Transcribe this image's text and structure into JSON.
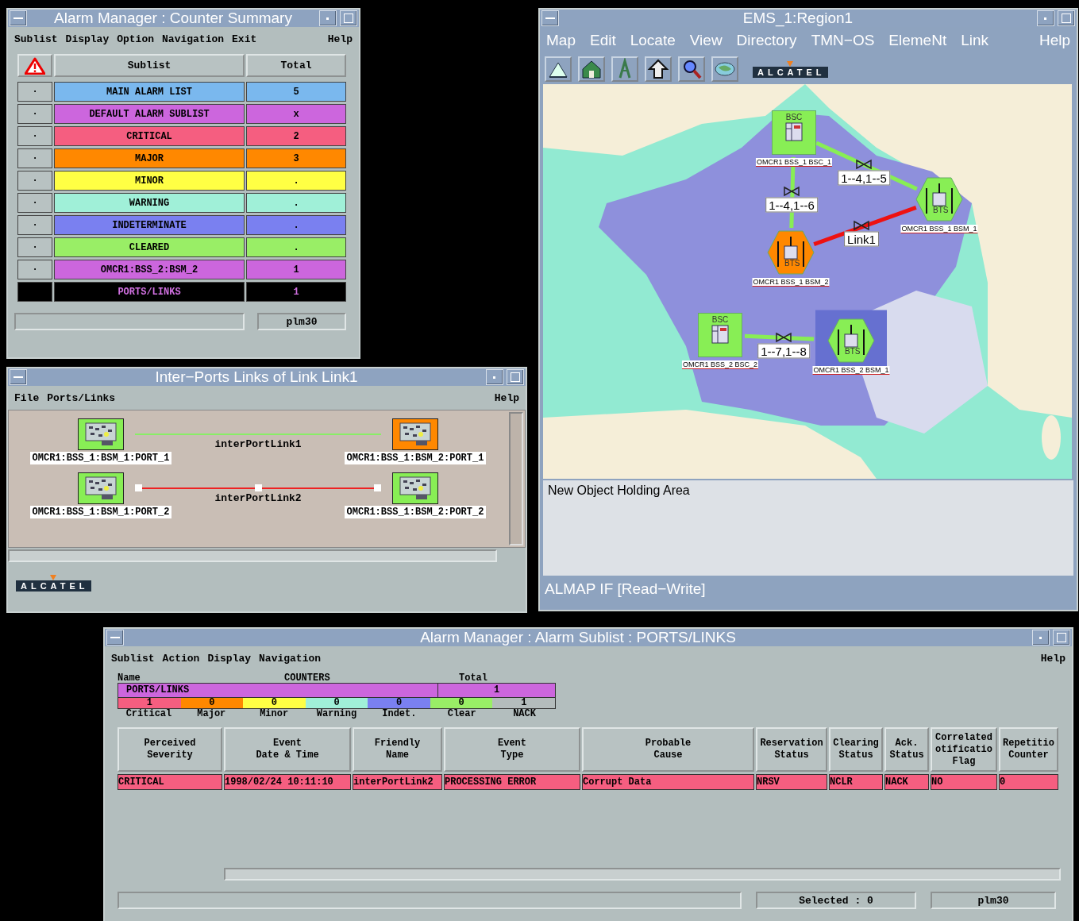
{
  "counter_summary": {
    "title": "Alarm Manager : Counter Summary",
    "menu": [
      "Sublist",
      "Display",
      "Option",
      "Navigation",
      "Exit"
    ],
    "help": "Help",
    "columns": [
      "Sublist",
      "Total"
    ],
    "rows": [
      {
        "marker": "·",
        "name": "MAIN ALARM LIST",
        "total": "5",
        "color": "#7ab8ee",
        "selected": false
      },
      {
        "marker": "·",
        "name": "DEFAULT ALARM SUBLIST",
        "total": "x",
        "color": "#cc66dd",
        "selected": false
      },
      {
        "marker": "·",
        "name": "CRITICAL",
        "total": "2",
        "color": "#f55e80",
        "selected": false
      },
      {
        "marker": "·",
        "name": "MAJOR",
        "total": "3",
        "color": "#ff8800",
        "selected": false
      },
      {
        "marker": "·",
        "name": "MINOR",
        "total": ".",
        "color": "#ffff44",
        "selected": false
      },
      {
        "marker": "·",
        "name": "WARNING",
        "total": ".",
        "color": "#a0f0d8",
        "selected": false
      },
      {
        "marker": "·",
        "name": "INDETERMINATE",
        "total": ".",
        "color": "#7a80f0",
        "selected": false
      },
      {
        "marker": "·",
        "name": "CLEARED",
        "total": ".",
        "color": "#99ee66",
        "selected": false
      },
      {
        "marker": "·",
        "name": "OMCR1:BSS_2:BSM_2",
        "total": "1",
        "color": "#cc66dd",
        "selected": false
      },
      {
        "name": "PORTS/LINKS",
        "total": "1",
        "selected": true
      }
    ],
    "host": "plm30"
  },
  "inter_ports": {
    "title": "Inter−Ports Links of Link Link1",
    "menu": [
      "File",
      "Ports/Links"
    ],
    "help": "Help",
    "links": [
      {
        "name": "interPortLink1",
        "color": "#88ee66",
        "selected": false,
        "ends": [
          {
            "label": "OMCR1:BSS_1:BSM_1:PORT_1",
            "color": "#88ee55"
          },
          {
            "label": "OMCR1:BSS_1:BSM_2:PORT_1",
            "color": "#ff8800"
          }
        ]
      },
      {
        "name": "interPortLink2",
        "color": "#ee2222",
        "selected": true,
        "ends": [
          {
            "label": "OMCR1:BSS_1:BSM_1:PORT_2",
            "color": "#88ee55"
          },
          {
            "label": "OMCR1:BSS_1:BSM_2:PORT_2",
            "color": "#88ee55"
          }
        ]
      }
    ],
    "logo": "ALCATEL"
  },
  "ems": {
    "title": "EMS_1:Region1",
    "menu": [
      "Map",
      "Edit",
      "Locate",
      "View",
      "Directory",
      "TMN−OS",
      "ElemeNt",
      "Link"
    ],
    "help": "Help",
    "logo": "ALCATEL",
    "nodes": [
      {
        "kind": "bsc",
        "tag": "BSC",
        "label": "OMCR1 BSS_1 BSC_1",
        "color": "#88ee55",
        "selected": false
      },
      {
        "kind": "bts",
        "tag": "BTS",
        "label": "OMCR1 BSS_1 BSM_1",
        "color": "#88ee55",
        "selected": false
      },
      {
        "kind": "bts",
        "tag": "BTS",
        "label": "OMCR1 BSS_1 BSM_2",
        "color": "#ff8800",
        "selected": false
      },
      {
        "kind": "bsc",
        "tag": "BSC",
        "label": "OMCR1 BSS_2 BSC_2",
        "color": "#88ee55",
        "selected": false
      },
      {
        "kind": "bts",
        "tag": "BTS",
        "label": "OMCR1 BSS_2 BSM_1",
        "color": "#88ee55",
        "selected": true
      }
    ],
    "links": [
      {
        "label": "1--4,1--5",
        "color": "#88ee55"
      },
      {
        "label": "1--4,1--6",
        "color": "#88ee55"
      },
      {
        "label": "Link1",
        "color": "#ee1111"
      },
      {
        "label": "1--7,1--8",
        "color": "#88ee55"
      }
    ],
    "holding_area": "New Object Holding Area",
    "status": "ALMAP IF [Read−Write]"
  },
  "sublist": {
    "title": "Alarm Manager : Alarm Sublist : PORTS/LINKS",
    "menu": [
      "Sublist",
      "Action",
      "Display",
      "Navigation"
    ],
    "help": "Help",
    "header": {
      "name": "Name",
      "counters": "COUNTERS",
      "total": "Total"
    },
    "name": "PORTS/LINKS",
    "total": "1",
    "counters": [
      {
        "label": "Critical",
        "value": "1",
        "color": "#f55e80"
      },
      {
        "label": "Major",
        "value": "0",
        "color": "#ff8800"
      },
      {
        "label": "Minor",
        "value": "0",
        "color": "#ffff44"
      },
      {
        "label": "Warning",
        "value": "0",
        "color": "#a0f0d8"
      },
      {
        "label": "Indet.",
        "value": "0",
        "color": "#7a80f0"
      },
      {
        "label": "Clear",
        "value": "0",
        "color": "#99ee66"
      },
      {
        "label": "NACK",
        "value": "1",
        "color": "#b4bcbc"
      }
    ],
    "columns": [
      "Perceived\nSeverity",
      "Event\nDate & Time",
      "Friendly\nName",
      "Event\nType",
      "Probable\nCause",
      "Reservation\nStatus",
      "Clearing\nStatus",
      "Ack.\nStatus",
      "Correlated\notificatio\nFlag",
      "Repetitio\nCounter"
    ],
    "rows": [
      {
        "color": "#f55e80",
        "cells": [
          "CRITICAL",
          "1998/02/24 10:11:10",
          "interPortLink2",
          "PROCESSING ERROR",
          "Corrupt Data",
          "NRSV",
          "NCLR",
          "NACK",
          "NO",
          "0"
        ]
      }
    ],
    "selected_count": "Selected : 0",
    "host": "plm30"
  }
}
